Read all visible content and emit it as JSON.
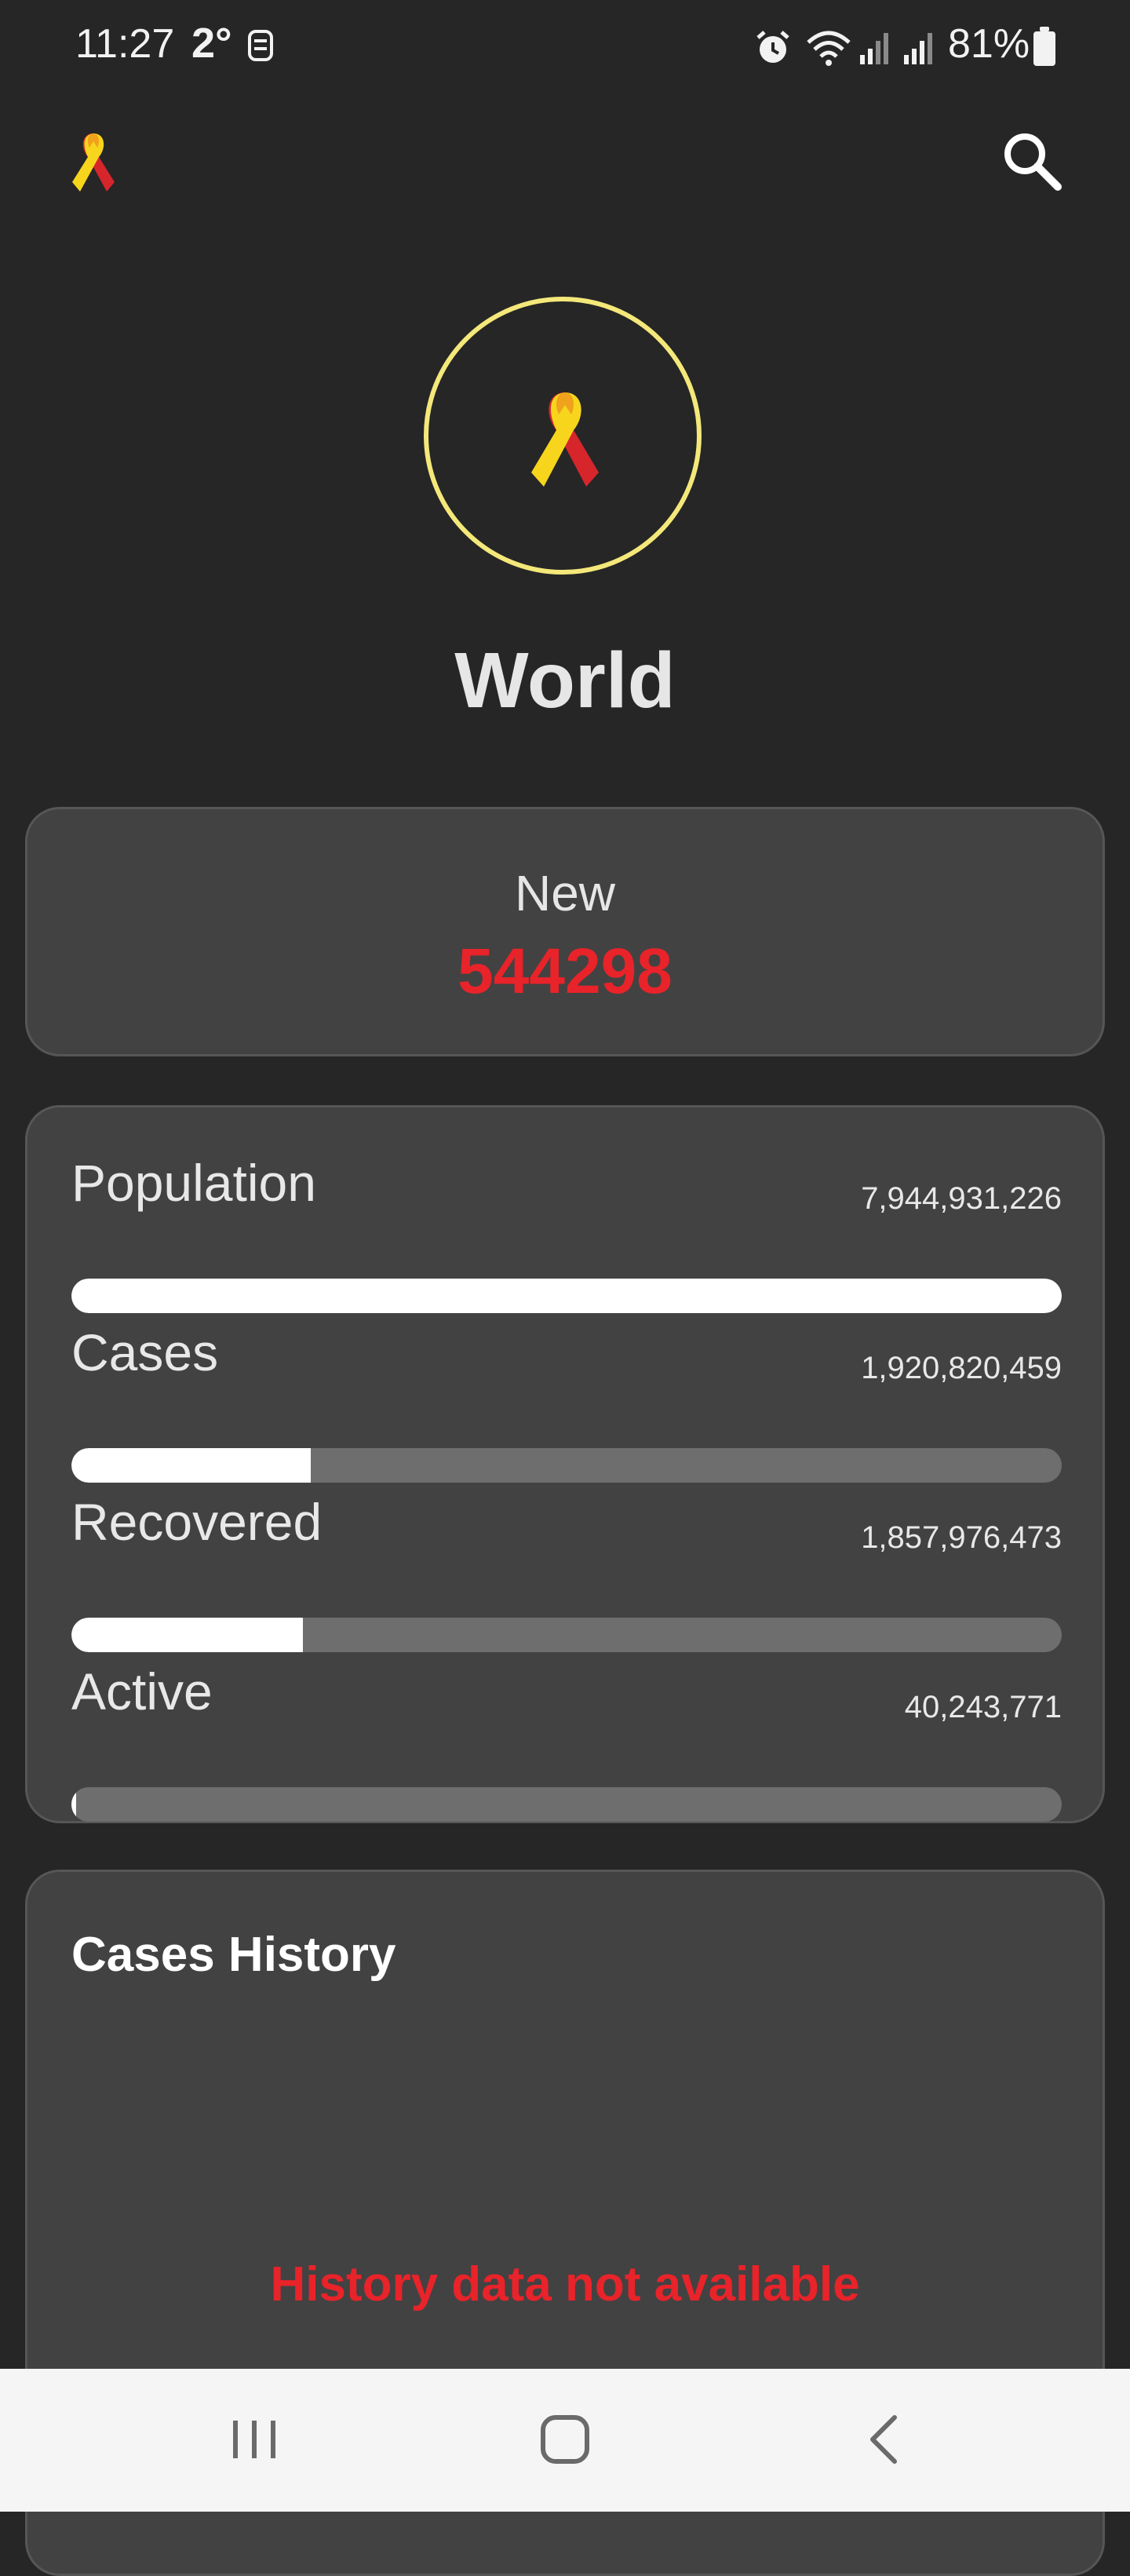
{
  "status_bar": {
    "time": "11:27",
    "temperature": "2°",
    "battery": "81%",
    "icons": [
      "notification-icon",
      "alarm-icon",
      "wifi-icon",
      "signal-icon",
      "signal-icon",
      "battery-icon"
    ]
  },
  "app_bar": {
    "logo_icon": "ribbon-icon",
    "search_icon": "search-icon"
  },
  "hero": {
    "icon": "ribbon-icon",
    "title": "World",
    "ring_color": "#f4e87a"
  },
  "new_cases": {
    "label": "New",
    "value": "544298",
    "color": "#e8232a"
  },
  "stats": [
    {
      "label": "Population",
      "value": "7,944,931,226",
      "fill_fraction": 1.0
    },
    {
      "label": "Cases",
      "value": "1,920,820,459",
      "fill_fraction": 0.2418
    },
    {
      "label": "Recovered",
      "value": "1,857,976,473",
      "fill_fraction": 0.2339
    },
    {
      "label": "Active",
      "value": "40,243,771",
      "fill_fraction": 0.0051
    }
  ],
  "history": {
    "title": "Cases History",
    "message": "History data not available"
  },
  "nav_bar": {
    "icons": [
      "recents-icon",
      "home-icon",
      "back-icon"
    ]
  }
}
